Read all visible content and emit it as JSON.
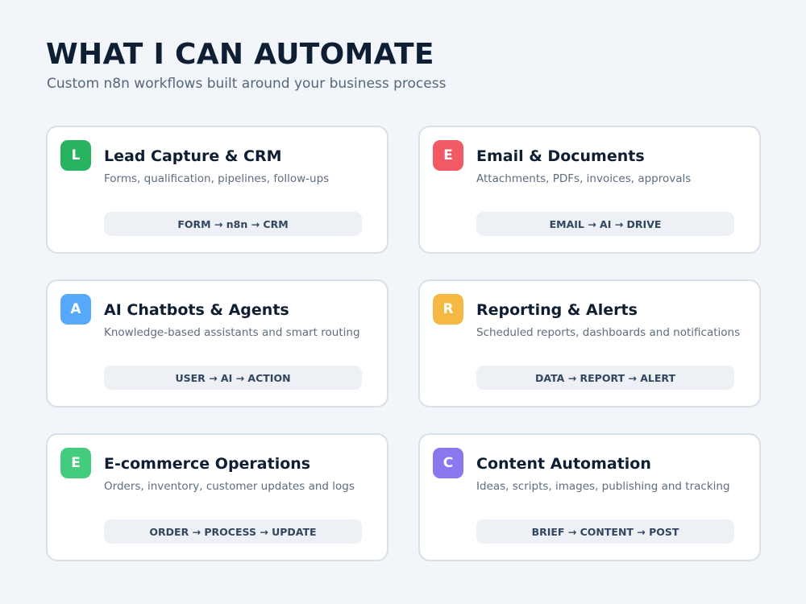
{
  "header": {
    "title": "WHAT I CAN AUTOMATE",
    "subtitle": "Custom n8n workflows built around your business process"
  },
  "cards": [
    {
      "letter": "L",
      "color": "#27b35f",
      "title": "Lead Capture & CRM",
      "description": "Forms, qualification, pipelines, follow-ups",
      "flow": "FORM → n8n → CRM"
    },
    {
      "letter": "E",
      "color": "#f25a66",
      "title": "Email & Documents",
      "description": "Attachments, PDFs, invoices, approvals",
      "flow": "EMAIL → AI → DRIVE"
    },
    {
      "letter": "A",
      "color": "#56a8fa",
      "title": "AI Chatbots & Agents",
      "description": "Knowledge-based assistants and smart routing",
      "flow": "USER → AI → ACTION"
    },
    {
      "letter": "R",
      "color": "#f5b843",
      "title": "Reporting & Alerts",
      "description": "Scheduled reports, dashboards and notifications",
      "flow": "DATA → REPORT → ALERT"
    },
    {
      "letter": "E",
      "color": "#43cc7e",
      "title": "E-commerce Operations",
      "description": "Orders, inventory, customer updates and logs",
      "flow": "ORDER → PROCESS → UPDATE"
    },
    {
      "letter": "C",
      "color": "#8a78ee",
      "title": "Content Automation",
      "description": "Ideas, scripts, images, publishing and tracking",
      "flow": "BRIEF → CONTENT → POST"
    }
  ]
}
